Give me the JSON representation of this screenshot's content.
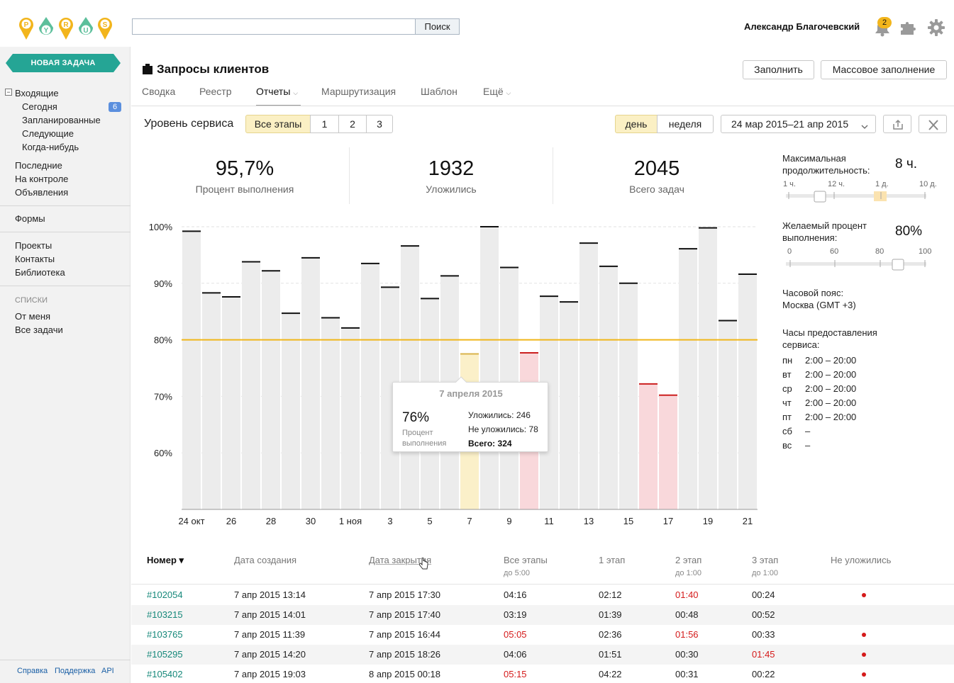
{
  "topbar": {
    "logo_letters": [
      "P",
      "Y",
      "R",
      "U",
      "S"
    ],
    "search_placeholder": "",
    "search_button": "Поиск",
    "user_name": "Александр Благочевский",
    "notifications_count": "2"
  },
  "sidebar": {
    "new_task": "НОВАЯ ЗАДАЧА",
    "inbox": {
      "label": "Входящие",
      "toggle": "−"
    },
    "inbox_items": [
      {
        "label": "Сегодня",
        "count": "6"
      },
      {
        "label": "Запланированные"
      },
      {
        "label": "Следующие"
      },
      {
        "label": "Когда-нибудь"
      }
    ],
    "group1": [
      "Последние",
      "На контроле",
      "Объявления"
    ],
    "group2": [
      "Формы"
    ],
    "group3": [
      "Проекты",
      "Контакты",
      "Библиотека"
    ],
    "lists_heading": "списки",
    "lists": [
      "От меня",
      "Все задачи"
    ],
    "footer": [
      "Справка",
      "Поддержка",
      "API"
    ]
  },
  "header": {
    "title": "Запросы клиентов",
    "fill_button": "Заполнить",
    "mass_fill_button": "Массовое заполнение",
    "tabs": [
      "Сводка",
      "Реестр",
      "Отчеты",
      "Маршрутизация",
      "Шаблон",
      "Ещё"
    ],
    "active_tab": "Отчеты"
  },
  "controls": {
    "report_label": "Уровень сервиса",
    "stages": [
      "Все этапы",
      "1",
      "2",
      "3"
    ],
    "selected_stage": "Все этапы",
    "periods": [
      "день",
      "неделя"
    ],
    "selected_period": "день",
    "date_range": "24 мар 2015–21 апр 2015"
  },
  "stats": [
    {
      "value": "95,7%",
      "label": "Процент выполнения"
    },
    {
      "value": "1932",
      "label": "Уложились"
    },
    {
      "value": "2045",
      "label": "Всего задач"
    }
  ],
  "settings": {
    "max_duration_label_1": "Максимальная",
    "max_duration_label_2": "продолжительность:",
    "max_duration_value": "8 ч.",
    "duration_ticks": [
      "1 ч.",
      "12 ч.",
      "1 д.",
      "10 д."
    ],
    "target_label_1": "Желаемый процент",
    "target_label_2": "выполнения:",
    "target_value": "80%",
    "target_ticks": [
      "0",
      "60",
      "80",
      "100"
    ],
    "target_slider_value": 80,
    "timezone_label": "Часовой пояс:",
    "timezone_value": "Москва (GMT +3)",
    "hours_label_1": "Часы предоставления",
    "hours_label_2": "сервиса:",
    "hours": [
      {
        "day": "пн",
        "time": "2:00 – 20:00"
      },
      {
        "day": "вт",
        "time": "2:00 – 20:00"
      },
      {
        "day": "ср",
        "time": "2:00 – 20:00"
      },
      {
        "day": "чт",
        "time": "2:00 – 20:00"
      },
      {
        "day": "пт",
        "time": "2:00 – 20:00"
      },
      {
        "day": "сб",
        "time": "–"
      },
      {
        "day": "вс",
        "time": "–"
      }
    ]
  },
  "tooltip": {
    "date": "7 апреля 2015",
    "percent": "76%",
    "percent_label_1": "Процент",
    "percent_label_2": "выполнения",
    "ok": "Уложились: 246",
    "late": "Не уложились: 78",
    "total": "Всего: 324"
  },
  "chart_data": {
    "type": "bar",
    "x_tick_labels": [
      "24 окт",
      "26",
      "28",
      "30",
      "1 ноя",
      "3",
      "5",
      "7",
      "9",
      "11",
      "13",
      "15",
      "17",
      "19",
      "21"
    ],
    "values": [
      99.2,
      88.3,
      87.6,
      93.8,
      92.2,
      84.7,
      94.5,
      83.9,
      82.1,
      93.5,
      89.3,
      96.6,
      87.3,
      91.3,
      77.5,
      100,
      92.8,
      77.7,
      87.7,
      86.7,
      97.1,
      93.0,
      90.0,
      72.2,
      70.2,
      96.1,
      99.8,
      83.4,
      91.6
    ],
    "ylim": [
      50,
      100
    ],
    "y_ticks": [
      "100%",
      "90%",
      "80%",
      "70%",
      "60%"
    ],
    "y_tick_values": [
      100,
      90,
      80,
      70,
      60
    ],
    "target": 80,
    "highlighted_index": 14,
    "colors": {
      "normal": "#ececec",
      "normal_line": "#111111",
      "below": "#f9d8db",
      "below_line": "#cc1f1f",
      "highlight": "#fbf0c9",
      "highlight_line": "#d9b34a",
      "target": "#f0b619"
    }
  },
  "table": {
    "headers": [
      "Номер ▾",
      "Дата создания",
      "Дата закрытия",
      "Все этапы",
      "1 этап",
      "2 этап",
      "3 этап",
      "Не уложились"
    ],
    "subheaders": {
      "all": "до 5:00",
      "s2": "до 1:00",
      "s3": "до 1:00"
    },
    "rows": [
      {
        "id": "#102054",
        "created": "7 апр 2015 13:14",
        "closed": "7 апр 2015 17:30",
        "all": "04:16",
        "s1": "02:12",
        "s2": "01:40",
        "s3": "00:24",
        "red": [
          "s2"
        ],
        "late": true
      },
      {
        "id": "#103215",
        "created": "7 апр 2015 14:01",
        "closed": "7 апр 2015 17:40",
        "all": "03:19",
        "s1": "01:39",
        "s2": "00:48",
        "s3": "00:52",
        "red": [],
        "late": false
      },
      {
        "id": "#103765",
        "created": "7 апр 2015 11:39",
        "closed": "7 апр 2015 16:44",
        "all": "05:05",
        "s1": "02:36",
        "s2": "01:56",
        "s3": "00:33",
        "red": [
          "all",
          "s2"
        ],
        "late": true
      },
      {
        "id": "#105295",
        "created": "7 апр 2015 14:20",
        "closed": "7 апр 2015 18:26",
        "all": "04:06",
        "s1": "01:51",
        "s2": "00:30",
        "s3": "01:45",
        "red": [
          "s3"
        ],
        "late": true
      },
      {
        "id": "#105402",
        "created": "7 апр 2015 19:03",
        "closed": "8 апр 2015 00:18",
        "all": "05:15",
        "s1": "04:22",
        "s2": "00:31",
        "s3": "00:22",
        "red": [
          "all"
        ],
        "late": true
      }
    ]
  }
}
